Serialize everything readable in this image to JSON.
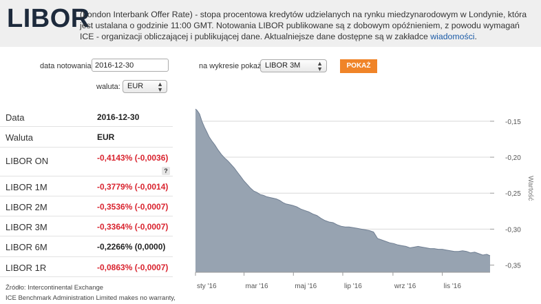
{
  "header": {
    "logo": "LIBOR",
    "description": "(London Interbank Offer Rate) - stopa procentowa kredytów udzielanych na rynku miedzynarodowym w Londynie, która jest ustalana o godzinie 11:00 GMT. Notowania LIBOR publikowane są z dobowym opóźnieniem, z powodu wymagań ICE - organizacji obliczającej i publikującej dane. Aktualniejsze dane dostępne są w zakładce ",
    "link": "wiadomości",
    "end": "."
  },
  "form": {
    "date_label": "data notowania:",
    "date_value": "2016-12-30",
    "chart_label": "na wykresie pokaż:",
    "chart_value": "LIBOR 3M",
    "button": "POKAŻ",
    "currency_label": "waluta:",
    "currency_value": "EUR"
  },
  "table": [
    {
      "label": "Data",
      "value": "2016-12-30",
      "style": "blk"
    },
    {
      "label": "Waluta",
      "value": "EUR",
      "style": "blk"
    },
    {
      "label": "LIBOR ON",
      "value": "-0,4143% (-0,0036)",
      "style": "neg",
      "help": "?"
    },
    {
      "label": "LIBOR 1M",
      "value": "-0,3779% (-0,0014)",
      "style": "neg"
    },
    {
      "label": "LIBOR 2M",
      "value": "-0,3536% (-0,0007)",
      "style": "neg"
    },
    {
      "label": "LIBOR 3M",
      "value": "-0,3364% (-0,0007)",
      "style": "neg"
    },
    {
      "label": "LIBOR 6M",
      "value": "-0,2266% (0,0000)",
      "style": "blk"
    },
    {
      "label": "LIBOR 1R",
      "value": "-0,0863% (-0,0007)",
      "style": "neg"
    }
  ],
  "source": {
    "line1": "Źródło: Intercontinental Exchange",
    "line2": "ICE Benchmark Administration Limited makes no warranty,"
  },
  "chart_data": {
    "type": "area",
    "ylabel": "Wartość",
    "ylim": [
      -0.36,
      -0.13
    ],
    "yticks": [
      "-0,15",
      "-0,20",
      "-0,25",
      "-0,30",
      "-0,35"
    ],
    "ytick_values": [
      -0.15,
      -0.2,
      -0.25,
      -0.3,
      -0.35
    ],
    "xticks": [
      "sty '16",
      "mar '16",
      "maj '16",
      "lip '16",
      "wrz '16",
      "lis '16"
    ],
    "xtick_days": [
      0,
      60,
      121,
      182,
      244,
      305
    ],
    "x_days": [
      0,
      2,
      5,
      8,
      11,
      14,
      17,
      20,
      24,
      28,
      32,
      36,
      40,
      44,
      48,
      52,
      56,
      60,
      64,
      68,
      72,
      76,
      80,
      84,
      88,
      92,
      96,
      100,
      104,
      108,
      112,
      116,
      120,
      125,
      130,
      135,
      140,
      145,
      150,
      155,
      160,
      165,
      170,
      175,
      180,
      185,
      190,
      195,
      200,
      205,
      210,
      215,
      220,
      225,
      230,
      235,
      240,
      245,
      250,
      255,
      260,
      265,
      270,
      275,
      280,
      285,
      290,
      295,
      300,
      305,
      310,
      315,
      320,
      325,
      330,
      335,
      340,
      345,
      350,
      355,
      360,
      364
    ],
    "values": [
      -0.133,
      -0.135,
      -0.14,
      -0.15,
      -0.158,
      -0.165,
      -0.172,
      -0.177,
      -0.183,
      -0.19,
      -0.196,
      -0.201,
      -0.205,
      -0.21,
      -0.215,
      -0.221,
      -0.227,
      -0.233,
      -0.238,
      -0.243,
      -0.247,
      -0.249,
      -0.252,
      -0.253,
      -0.255,
      -0.256,
      -0.257,
      -0.258,
      -0.26,
      -0.263,
      -0.265,
      -0.266,
      -0.267,
      -0.269,
      -0.272,
      -0.274,
      -0.276,
      -0.279,
      -0.281,
      -0.285,
      -0.288,
      -0.29,
      -0.291,
      -0.294,
      -0.296,
      -0.297,
      -0.297,
      -0.298,
      -0.299,
      -0.3,
      -0.301,
      -0.302,
      -0.304,
      -0.313,
      -0.315,
      -0.317,
      -0.319,
      -0.32,
      -0.322,
      -0.323,
      -0.324,
      -0.326,
      -0.325,
      -0.324,
      -0.325,
      -0.326,
      -0.327,
      -0.327,
      -0.328,
      -0.328,
      -0.329,
      -0.33,
      -0.331,
      -0.331,
      -0.33,
      -0.331,
      -0.333,
      -0.332,
      -0.334,
      -0.336,
      -0.335,
      -0.337
    ],
    "colors": {
      "fill": "#97a3b1",
      "line": "#6f7e92",
      "grid": "#d8d8d8",
      "axis": "#999999"
    }
  }
}
